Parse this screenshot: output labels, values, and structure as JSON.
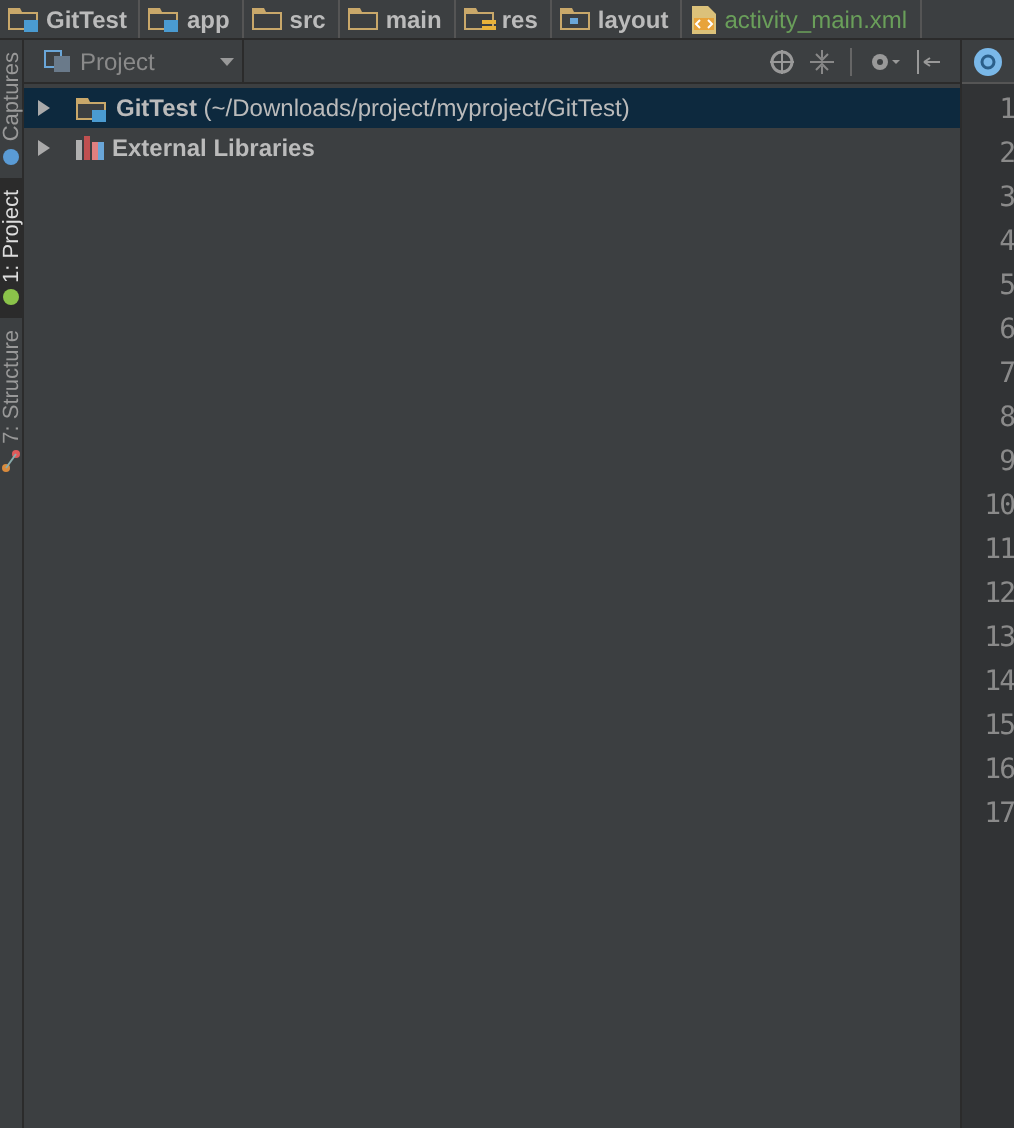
{
  "breadcrumbs": [
    {
      "label": "GitTest",
      "kind": "module"
    },
    {
      "label": "app",
      "kind": "module"
    },
    {
      "label": "src",
      "kind": "folder"
    },
    {
      "label": "main",
      "kind": "folder"
    },
    {
      "label": "res",
      "kind": "res"
    },
    {
      "label": "layout",
      "kind": "layout"
    },
    {
      "label": "activity_main.xml",
      "kind": "file"
    }
  ],
  "side_tabs": [
    {
      "label": "Captures",
      "selected": false,
      "kind": "captures"
    },
    {
      "label": "1: Project",
      "selected": true,
      "kind": "project"
    },
    {
      "label": "7: Structure",
      "selected": false,
      "kind": "structure"
    }
  ],
  "project_panel": {
    "view_selector": "Project",
    "tree": [
      {
        "name": "GitTest",
        "path": "(~/Downloads/project/myproject/GitTest)",
        "kind": "module",
        "expanded": false,
        "selected": true
      },
      {
        "name": "External Libraries",
        "kind": "libraries",
        "expanded": false,
        "selected": false
      }
    ]
  },
  "editor": {
    "line_numbers": [
      "1",
      "2",
      "3",
      "4",
      "5",
      "6",
      "7",
      "8",
      "9",
      "10",
      "11",
      "12",
      "13",
      "14",
      "15",
      "16",
      "17"
    ]
  }
}
